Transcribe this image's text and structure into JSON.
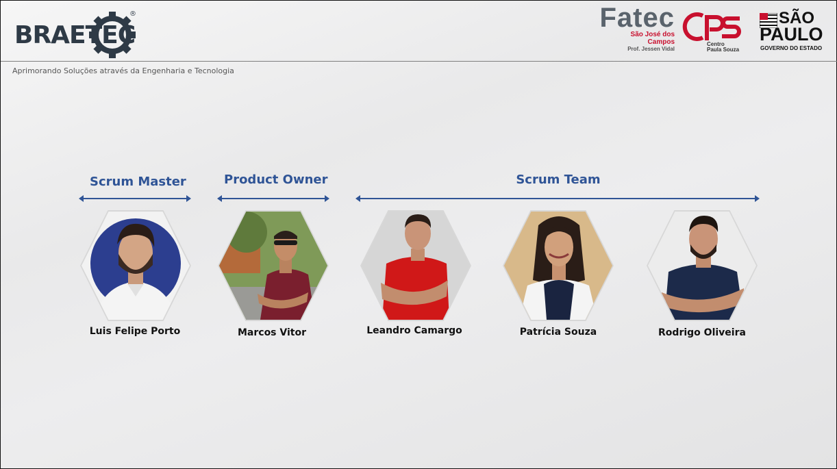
{
  "header": {
    "brand": {
      "name": "BRAETEC",
      "registered": "®"
    },
    "tagline": "Aprimorando Soluções através da Engenharia e Tecnologia",
    "fatec": {
      "name": "Fatec",
      "campus_line1": "São José dos",
      "campus_line2": "Campos",
      "prof": "Prof. Jessen Vidal"
    },
    "cps": {
      "logo": "CPS",
      "line1": "Centro",
      "line2": "Paula Souza"
    },
    "sao_paulo": {
      "line1": "SÃO",
      "line2": "PAULO",
      "line3": "GOVERNO DO ESTADO"
    }
  },
  "roles": [
    {
      "label": "Scrum Master"
    },
    {
      "label": "Product Owner"
    },
    {
      "label": "Scrum Team"
    }
  ],
  "members": [
    {
      "name": "Luis Felipe Porto",
      "role": "Scrum Master",
      "photo_bg": "#2c3e8f",
      "shirt": "#f2f2f2"
    },
    {
      "name": "Marcos Vitor",
      "role": "Product Owner",
      "photo_bg": "#6e8a4a",
      "shirt": "#7a1f2e"
    },
    {
      "name": "Leandro Camargo",
      "role": "Scrum Team",
      "photo_bg": "#d9d9d9",
      "shirt": "#d01818"
    },
    {
      "name": "Patrícia Souza",
      "role": "Scrum Team",
      "photo_bg": "#d8b98a",
      "shirt": "#1a2440"
    },
    {
      "name": "Rodrigo Oliveira",
      "role": "Scrum Team",
      "photo_bg": "#e9e9e9",
      "shirt": "#1c2a4a"
    }
  ],
  "colors": {
    "accent": "#2f5496",
    "fatec_red": "#c8102e",
    "brand_dark": "#2e3a46"
  }
}
